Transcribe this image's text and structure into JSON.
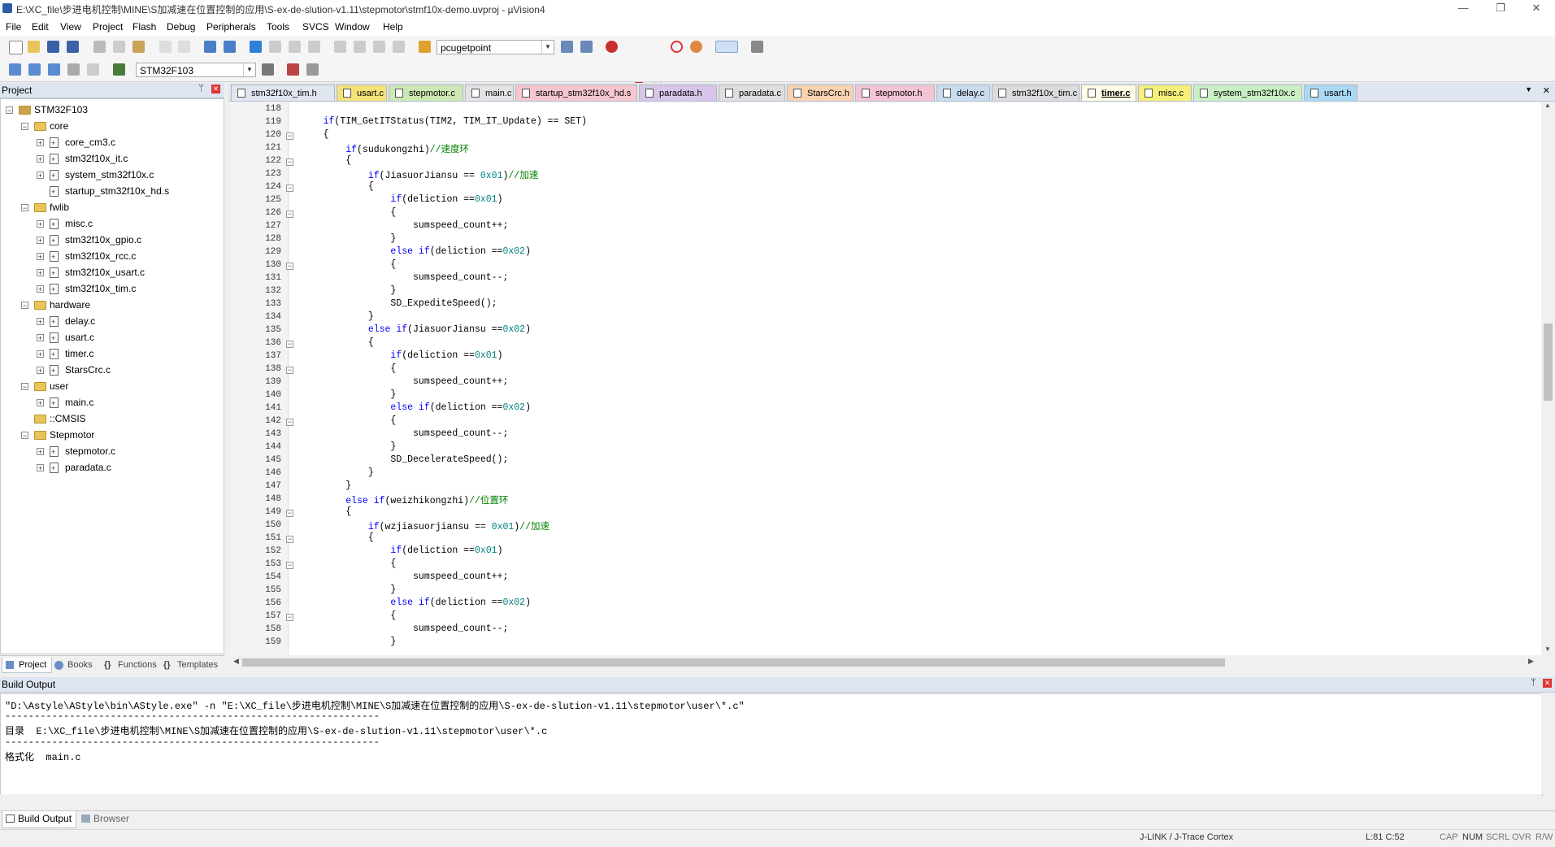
{
  "window": {
    "title": "E:\\XC_file\\步进电机控制\\MINE\\S加减速在位置控制的应用\\S-ex-de-slution-v1.11\\stepmotor\\stmf10x-demo.uvproj - µVision4",
    "minimize": "—",
    "restore": "❐",
    "close": "✕"
  },
  "menu": [
    "File",
    "Edit",
    "View",
    "Project",
    "Flash",
    "Debug",
    "Peripherals",
    "Tools",
    "SVCS",
    "Window",
    "Help"
  ],
  "toolbar": {
    "find_value": "pcugetpoint",
    "target_value": "STM32F103"
  },
  "project": {
    "header": "Project",
    "pin": "ᛘ",
    "close": "✕",
    "tree": [
      {
        "label": "STM32F103",
        "level": 0,
        "kind": "root",
        "exp": "−"
      },
      {
        "label": "core",
        "level": 1,
        "kind": "folder",
        "exp": "−"
      },
      {
        "label": "core_cm3.c",
        "level": 2,
        "kind": "file",
        "exp": "+"
      },
      {
        "label": "stm32f10x_it.c",
        "level": 2,
        "kind": "file",
        "exp": "+"
      },
      {
        "label": "system_stm32f10x.c",
        "level": 2,
        "kind": "file",
        "exp": "+"
      },
      {
        "label": "startup_stm32f10x_hd.s",
        "level": 2,
        "kind": "file",
        "exp": ""
      },
      {
        "label": "fwlib",
        "level": 1,
        "kind": "folder",
        "exp": "−"
      },
      {
        "label": "misc.c",
        "level": 2,
        "kind": "file",
        "exp": "+"
      },
      {
        "label": "stm32f10x_gpio.c",
        "level": 2,
        "kind": "file",
        "exp": "+"
      },
      {
        "label": "stm32f10x_rcc.c",
        "level": 2,
        "kind": "file",
        "exp": "+"
      },
      {
        "label": "stm32f10x_usart.c",
        "level": 2,
        "kind": "file",
        "exp": "+"
      },
      {
        "label": "stm32f10x_tim.c",
        "level": 2,
        "kind": "file",
        "exp": "+"
      },
      {
        "label": "hardware",
        "level": 1,
        "kind": "folder",
        "exp": "−"
      },
      {
        "label": "delay.c",
        "level": 2,
        "kind": "file",
        "exp": "+"
      },
      {
        "label": "usart.c",
        "level": 2,
        "kind": "file",
        "exp": "+"
      },
      {
        "label": "timer.c",
        "level": 2,
        "kind": "file",
        "exp": "+"
      },
      {
        "label": "StarsCrc.c",
        "level": 2,
        "kind": "file",
        "exp": "+"
      },
      {
        "label": "user",
        "level": 1,
        "kind": "folder",
        "exp": "−"
      },
      {
        "label": "main.c",
        "level": 2,
        "kind": "file",
        "exp": "+"
      },
      {
        "label": "::CMSIS",
        "level": 1,
        "kind": "folder",
        "exp": ""
      },
      {
        "label": "Stepmotor",
        "level": 1,
        "kind": "folder",
        "exp": "−"
      },
      {
        "label": "stepmotor.c",
        "level": 2,
        "kind": "file",
        "exp": "+"
      },
      {
        "label": "paradata.c",
        "level": 2,
        "kind": "file",
        "exp": "+"
      }
    ],
    "tabs": [
      "Project",
      "Books",
      "Functions",
      "Templates"
    ]
  },
  "editor_tabs": [
    {
      "label": "stm32f10x_tim.h",
      "color": "#dfe6ef",
      "active": false
    },
    {
      "label": "usart.c",
      "color": "#f4e27a",
      "active": false
    },
    {
      "label": "stepmotor.c",
      "color": "#cde8b4",
      "active": false
    },
    {
      "label": "main.c",
      "color": "#e3e3e3",
      "active": false
    },
    {
      "label": "startup_stm32f10x_hd.s",
      "color": "#f6c6cf",
      "active": false
    },
    {
      "label": "paradata.h",
      "color": "#d8c6ea",
      "active": false
    },
    {
      "label": "paradata.c",
      "color": "#dedede",
      "active": false
    },
    {
      "label": "StarsCrc.h",
      "color": "#f7d3b1",
      "active": false
    },
    {
      "label": "stepmotor.h",
      "color": "#f3c4d6",
      "active": false
    },
    {
      "label": "delay.c",
      "color": "#c9dcef",
      "active": false
    },
    {
      "label": "stm32f10x_tim.c",
      "color": "#dcdcdc",
      "active": false
    },
    {
      "label": "timer.c",
      "color": "#fff3c4",
      "active": true
    },
    {
      "label": "misc.c",
      "color": "#f4f07a",
      "active": false
    },
    {
      "label": "system_stm32f10x.c",
      "color": "#c9f0c4",
      "active": false
    },
    {
      "label": "usart.h",
      "color": "#a8d8f4",
      "active": false
    }
  ],
  "editor_tab_menu": "▼",
  "editor_tab_close": "✕",
  "code": [
    {
      "n": "118",
      "fold": "",
      "t": []
    },
    {
      "n": "119",
      "fold": "",
      "t": [
        [
          "    ",
          "p"
        ],
        [
          "if",
          "kw"
        ],
        [
          "(TIM_GetITStatus(TIM2, TIM_IT_Update) == SET)",
          "p"
        ]
      ]
    },
    {
      "n": "120",
      "fold": "−",
      "t": [
        [
          "    {",
          "p"
        ]
      ]
    },
    {
      "n": "121",
      "fold": "",
      "t": [
        [
          "        ",
          "p"
        ],
        [
          "if",
          "kw"
        ],
        [
          "(sudukongzhi)",
          "p"
        ],
        [
          "//速度环",
          "cm"
        ]
      ]
    },
    {
      "n": "122",
      "fold": "−",
      "t": [
        [
          "        {",
          "p"
        ]
      ]
    },
    {
      "n": "123",
      "fold": "",
      "t": [
        [
          "            ",
          "p"
        ],
        [
          "if",
          "kw"
        ],
        [
          "(JiasuorJiansu == ",
          "p"
        ],
        [
          "0x01",
          "num"
        ],
        [
          ")",
          "p"
        ],
        [
          "//加速",
          "cm"
        ]
      ]
    },
    {
      "n": "124",
      "fold": "−",
      "t": [
        [
          "            {",
          "p"
        ]
      ]
    },
    {
      "n": "125",
      "fold": "",
      "t": [
        [
          "                ",
          "p"
        ],
        [
          "if",
          "kw"
        ],
        [
          "(deliction ==",
          "p"
        ],
        [
          "0x01",
          "num"
        ],
        [
          ")",
          "p"
        ]
      ]
    },
    {
      "n": "126",
      "fold": "−",
      "t": [
        [
          "                {",
          "p"
        ]
      ]
    },
    {
      "n": "127",
      "fold": "",
      "t": [
        [
          "                    sumspeed_count++;",
          "p"
        ]
      ]
    },
    {
      "n": "128",
      "fold": "",
      "t": [
        [
          "                }",
          "p"
        ]
      ]
    },
    {
      "n": "129",
      "fold": "",
      "t": [
        [
          "                ",
          "p"
        ],
        [
          "else if",
          "kw"
        ],
        [
          "(deliction ==",
          "p"
        ],
        [
          "0x02",
          "num"
        ],
        [
          ")",
          "p"
        ]
      ]
    },
    {
      "n": "130",
      "fold": "−",
      "t": [
        [
          "                {",
          "p"
        ]
      ]
    },
    {
      "n": "131",
      "fold": "",
      "t": [
        [
          "                    sumspeed_count--;",
          "p"
        ]
      ]
    },
    {
      "n": "132",
      "fold": "",
      "t": [
        [
          "                }",
          "p"
        ]
      ]
    },
    {
      "n": "133",
      "fold": "",
      "t": [
        [
          "                SD_ExpediteSpeed();",
          "p"
        ]
      ]
    },
    {
      "n": "134",
      "fold": "",
      "t": [
        [
          "            }",
          "p"
        ]
      ]
    },
    {
      "n": "135",
      "fold": "",
      "t": [
        [
          "            ",
          "p"
        ],
        [
          "else if",
          "kw"
        ],
        [
          "(JiasuorJiansu ==",
          "p"
        ],
        [
          "0x02",
          "num"
        ],
        [
          ")",
          "p"
        ]
      ]
    },
    {
      "n": "136",
      "fold": "−",
      "t": [
        [
          "            {",
          "p"
        ]
      ]
    },
    {
      "n": "137",
      "fold": "",
      "t": [
        [
          "                ",
          "p"
        ],
        [
          "if",
          "kw"
        ],
        [
          "(deliction ==",
          "p"
        ],
        [
          "0x01",
          "num"
        ],
        [
          ")",
          "p"
        ]
      ]
    },
    {
      "n": "138",
      "fold": "−",
      "t": [
        [
          "                {",
          "p"
        ]
      ]
    },
    {
      "n": "139",
      "fold": "",
      "t": [
        [
          "                    sumspeed_count++;",
          "p"
        ]
      ]
    },
    {
      "n": "140",
      "fold": "",
      "t": [
        [
          "                }",
          "p"
        ]
      ]
    },
    {
      "n": "141",
      "fold": "",
      "t": [
        [
          "                ",
          "p"
        ],
        [
          "else if",
          "kw"
        ],
        [
          "(deliction ==",
          "p"
        ],
        [
          "0x02",
          "num"
        ],
        [
          ")",
          "p"
        ]
      ]
    },
    {
      "n": "142",
      "fold": "−",
      "t": [
        [
          "                {",
          "p"
        ]
      ]
    },
    {
      "n": "143",
      "fold": "",
      "t": [
        [
          "                    sumspeed_count--;",
          "p"
        ]
      ]
    },
    {
      "n": "144",
      "fold": "",
      "t": [
        [
          "                }",
          "p"
        ]
      ]
    },
    {
      "n": "145",
      "fold": "",
      "t": [
        [
          "                SD_DecelerateSpeed();",
          "p"
        ]
      ]
    },
    {
      "n": "146",
      "fold": "",
      "t": [
        [
          "            }",
          "p"
        ]
      ]
    },
    {
      "n": "147",
      "fold": "",
      "t": [
        [
          "        }",
          "p"
        ]
      ]
    },
    {
      "n": "148",
      "fold": "",
      "t": [
        [
          "        ",
          "p"
        ],
        [
          "else if",
          "kw"
        ],
        [
          "(weizhikongzhi)",
          "p"
        ],
        [
          "//位置环",
          "cm"
        ]
      ]
    },
    {
      "n": "149",
      "fold": "−",
      "t": [
        [
          "        {",
          "p"
        ]
      ]
    },
    {
      "n": "150",
      "fold": "",
      "t": [
        [
          "            ",
          "p"
        ],
        [
          "if",
          "kw"
        ],
        [
          "(wzjiasuorjiansu == ",
          "p"
        ],
        [
          "0x01",
          "num"
        ],
        [
          ")",
          "p"
        ],
        [
          "//加速",
          "cm"
        ]
      ]
    },
    {
      "n": "151",
      "fold": "−",
      "t": [
        [
          "            {",
          "p"
        ]
      ]
    },
    {
      "n": "152",
      "fold": "",
      "t": [
        [
          "                ",
          "p"
        ],
        [
          "if",
          "kw"
        ],
        [
          "(deliction ==",
          "p"
        ],
        [
          "0x01",
          "num"
        ],
        [
          ")",
          "p"
        ]
      ]
    },
    {
      "n": "153",
      "fold": "−",
      "t": [
        [
          "                {",
          "p"
        ]
      ]
    },
    {
      "n": "154",
      "fold": "",
      "t": [
        [
          "                    sumspeed_count++;",
          "p"
        ]
      ]
    },
    {
      "n": "155",
      "fold": "",
      "t": [
        [
          "                }",
          "p"
        ]
      ]
    },
    {
      "n": "156",
      "fold": "",
      "t": [
        [
          "                ",
          "p"
        ],
        [
          "else if",
          "kw"
        ],
        [
          "(deliction ==",
          "p"
        ],
        [
          "0x02",
          "num"
        ],
        [
          ")",
          "p"
        ]
      ]
    },
    {
      "n": "157",
      "fold": "−",
      "t": [
        [
          "                {",
          "p"
        ]
      ]
    },
    {
      "n": "158",
      "fold": "",
      "t": [
        [
          "                    sumspeed_count--;",
          "p"
        ]
      ]
    },
    {
      "n": "159",
      "fold": "",
      "t": [
        [
          "                }",
          "p"
        ]
      ]
    }
  ],
  "build_output": {
    "header": "Build Output",
    "pin": "ᛘ",
    "close": "✕",
    "lines": [
      "\"D:\\Astyle\\AStyle\\bin\\AStyle.exe\" -n \"E:\\XC_file\\步进电机控制\\MINE\\S加减速在位置控制的应用\\S-ex-de-slution-v1.11\\stepmotor\\user\\*.c\"",
      "----------------------------------------------------------------",
      "目录  E:\\XC_file\\步进电机控制\\MINE\\S加减速在位置控制的应用\\S-ex-de-slution-v1.11\\stepmotor\\user\\*.c",
      "----------------------------------------------------------------",
      "格式化  main.c"
    ],
    "tabs": [
      "Build Output",
      "Browser"
    ]
  },
  "status": {
    "debugger": "J-LINK / J-Trace Cortex",
    "position": "L:81 C:52",
    "cap": "CAP",
    "num": "NUM",
    "scrl": "SCRL",
    "ovr": "OVR",
    "rw": "R/W"
  }
}
